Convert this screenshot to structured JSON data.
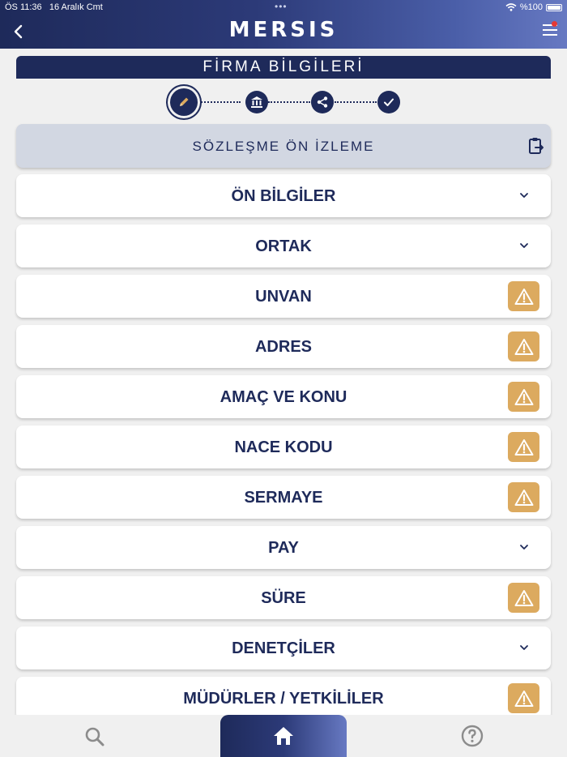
{
  "status_bar": {
    "time": "ÖS 11:36",
    "date": "16 Aralık Cmt",
    "battery": "%100"
  },
  "header": {
    "brand": "MERSIS"
  },
  "section": {
    "title": "FİRMA BİLGİLERİ"
  },
  "stepper": {
    "steps": [
      "pencil-icon",
      "bank-icon",
      "share-icon",
      "check-icon"
    ],
    "active_index": 0
  },
  "preview": {
    "label": "SÖZLEŞME ÖN İZLEME"
  },
  "accordion": [
    {
      "label": "ÖN BİLGİLER",
      "indicator": "chevron"
    },
    {
      "label": "ORTAK",
      "indicator": "chevron"
    },
    {
      "label": "UNVAN",
      "indicator": "warning"
    },
    {
      "label": "ADRES",
      "indicator": "warning"
    },
    {
      "label": "AMAÇ VE KONU",
      "indicator": "warning"
    },
    {
      "label": "NACE KODU",
      "indicator": "warning"
    },
    {
      "label": "SERMAYE",
      "indicator": "warning"
    },
    {
      "label": "PAY",
      "indicator": "chevron"
    },
    {
      "label": "SÜRE",
      "indicator": "warning"
    },
    {
      "label": "DENETÇİLER",
      "indicator": "chevron"
    },
    {
      "label": "MÜDÜRLER / YETKİLİLER",
      "indicator": "warning"
    }
  ],
  "colors": {
    "primary": "#1e2a5a",
    "warning": "#dcaa5f",
    "background": "#f0f0f0",
    "preview_bg": "#d2d7e2"
  },
  "bottom_nav": [
    "search-icon",
    "home-icon",
    "help-icon"
  ]
}
